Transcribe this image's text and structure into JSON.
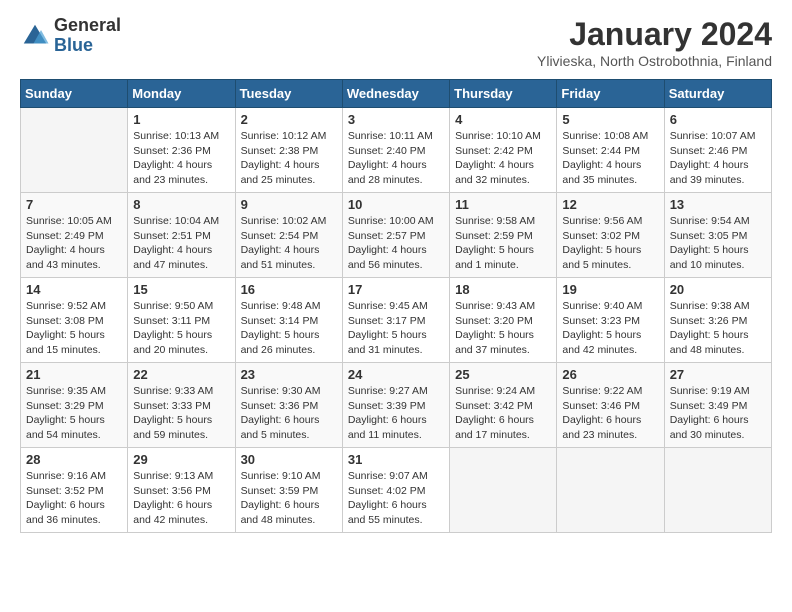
{
  "logo": {
    "general": "General",
    "blue": "Blue"
  },
  "title": "January 2024",
  "location": "Ylivieska, North Ostrobothnia, Finland",
  "days_header": [
    "Sunday",
    "Monday",
    "Tuesday",
    "Wednesday",
    "Thursday",
    "Friday",
    "Saturday"
  ],
  "weeks": [
    [
      {
        "day": "",
        "info": ""
      },
      {
        "day": "1",
        "info": "Sunrise: 10:13 AM\nSunset: 2:36 PM\nDaylight: 4 hours\nand 23 minutes."
      },
      {
        "day": "2",
        "info": "Sunrise: 10:12 AM\nSunset: 2:38 PM\nDaylight: 4 hours\nand 25 minutes."
      },
      {
        "day": "3",
        "info": "Sunrise: 10:11 AM\nSunset: 2:40 PM\nDaylight: 4 hours\nand 28 minutes."
      },
      {
        "day": "4",
        "info": "Sunrise: 10:10 AM\nSunset: 2:42 PM\nDaylight: 4 hours\nand 32 minutes."
      },
      {
        "day": "5",
        "info": "Sunrise: 10:08 AM\nSunset: 2:44 PM\nDaylight: 4 hours\nand 35 minutes."
      },
      {
        "day": "6",
        "info": "Sunrise: 10:07 AM\nSunset: 2:46 PM\nDaylight: 4 hours\nand 39 minutes."
      }
    ],
    [
      {
        "day": "7",
        "info": "Sunrise: 10:05 AM\nSunset: 2:49 PM\nDaylight: 4 hours\nand 43 minutes."
      },
      {
        "day": "8",
        "info": "Sunrise: 10:04 AM\nSunset: 2:51 PM\nDaylight: 4 hours\nand 47 minutes."
      },
      {
        "day": "9",
        "info": "Sunrise: 10:02 AM\nSunset: 2:54 PM\nDaylight: 4 hours\nand 51 minutes."
      },
      {
        "day": "10",
        "info": "Sunrise: 10:00 AM\nSunset: 2:57 PM\nDaylight: 4 hours\nand 56 minutes."
      },
      {
        "day": "11",
        "info": "Sunrise: 9:58 AM\nSunset: 2:59 PM\nDaylight: 5 hours\nand 1 minute."
      },
      {
        "day": "12",
        "info": "Sunrise: 9:56 AM\nSunset: 3:02 PM\nDaylight: 5 hours\nand 5 minutes."
      },
      {
        "day": "13",
        "info": "Sunrise: 9:54 AM\nSunset: 3:05 PM\nDaylight: 5 hours\nand 10 minutes."
      }
    ],
    [
      {
        "day": "14",
        "info": "Sunrise: 9:52 AM\nSunset: 3:08 PM\nDaylight: 5 hours\nand 15 minutes."
      },
      {
        "day": "15",
        "info": "Sunrise: 9:50 AM\nSunset: 3:11 PM\nDaylight: 5 hours\nand 20 minutes."
      },
      {
        "day": "16",
        "info": "Sunrise: 9:48 AM\nSunset: 3:14 PM\nDaylight: 5 hours\nand 26 minutes."
      },
      {
        "day": "17",
        "info": "Sunrise: 9:45 AM\nSunset: 3:17 PM\nDaylight: 5 hours\nand 31 minutes."
      },
      {
        "day": "18",
        "info": "Sunrise: 9:43 AM\nSunset: 3:20 PM\nDaylight: 5 hours\nand 37 minutes."
      },
      {
        "day": "19",
        "info": "Sunrise: 9:40 AM\nSunset: 3:23 PM\nDaylight: 5 hours\nand 42 minutes."
      },
      {
        "day": "20",
        "info": "Sunrise: 9:38 AM\nSunset: 3:26 PM\nDaylight: 5 hours\nand 48 minutes."
      }
    ],
    [
      {
        "day": "21",
        "info": "Sunrise: 9:35 AM\nSunset: 3:29 PM\nDaylight: 5 hours\nand 54 minutes."
      },
      {
        "day": "22",
        "info": "Sunrise: 9:33 AM\nSunset: 3:33 PM\nDaylight: 5 hours\nand 59 minutes."
      },
      {
        "day": "23",
        "info": "Sunrise: 9:30 AM\nSunset: 3:36 PM\nDaylight: 6 hours\nand 5 minutes."
      },
      {
        "day": "24",
        "info": "Sunrise: 9:27 AM\nSunset: 3:39 PM\nDaylight: 6 hours\nand 11 minutes."
      },
      {
        "day": "25",
        "info": "Sunrise: 9:24 AM\nSunset: 3:42 PM\nDaylight: 6 hours\nand 17 minutes."
      },
      {
        "day": "26",
        "info": "Sunrise: 9:22 AM\nSunset: 3:46 PM\nDaylight: 6 hours\nand 23 minutes."
      },
      {
        "day": "27",
        "info": "Sunrise: 9:19 AM\nSunset: 3:49 PM\nDaylight: 6 hours\nand 30 minutes."
      }
    ],
    [
      {
        "day": "28",
        "info": "Sunrise: 9:16 AM\nSunset: 3:52 PM\nDaylight: 6 hours\nand 36 minutes."
      },
      {
        "day": "29",
        "info": "Sunrise: 9:13 AM\nSunset: 3:56 PM\nDaylight: 6 hours\nand 42 minutes."
      },
      {
        "day": "30",
        "info": "Sunrise: 9:10 AM\nSunset: 3:59 PM\nDaylight: 6 hours\nand 48 minutes."
      },
      {
        "day": "31",
        "info": "Sunrise: 9:07 AM\nSunset: 4:02 PM\nDaylight: 6 hours\nand 55 minutes."
      },
      {
        "day": "",
        "info": ""
      },
      {
        "day": "",
        "info": ""
      },
      {
        "day": "",
        "info": ""
      }
    ]
  ]
}
